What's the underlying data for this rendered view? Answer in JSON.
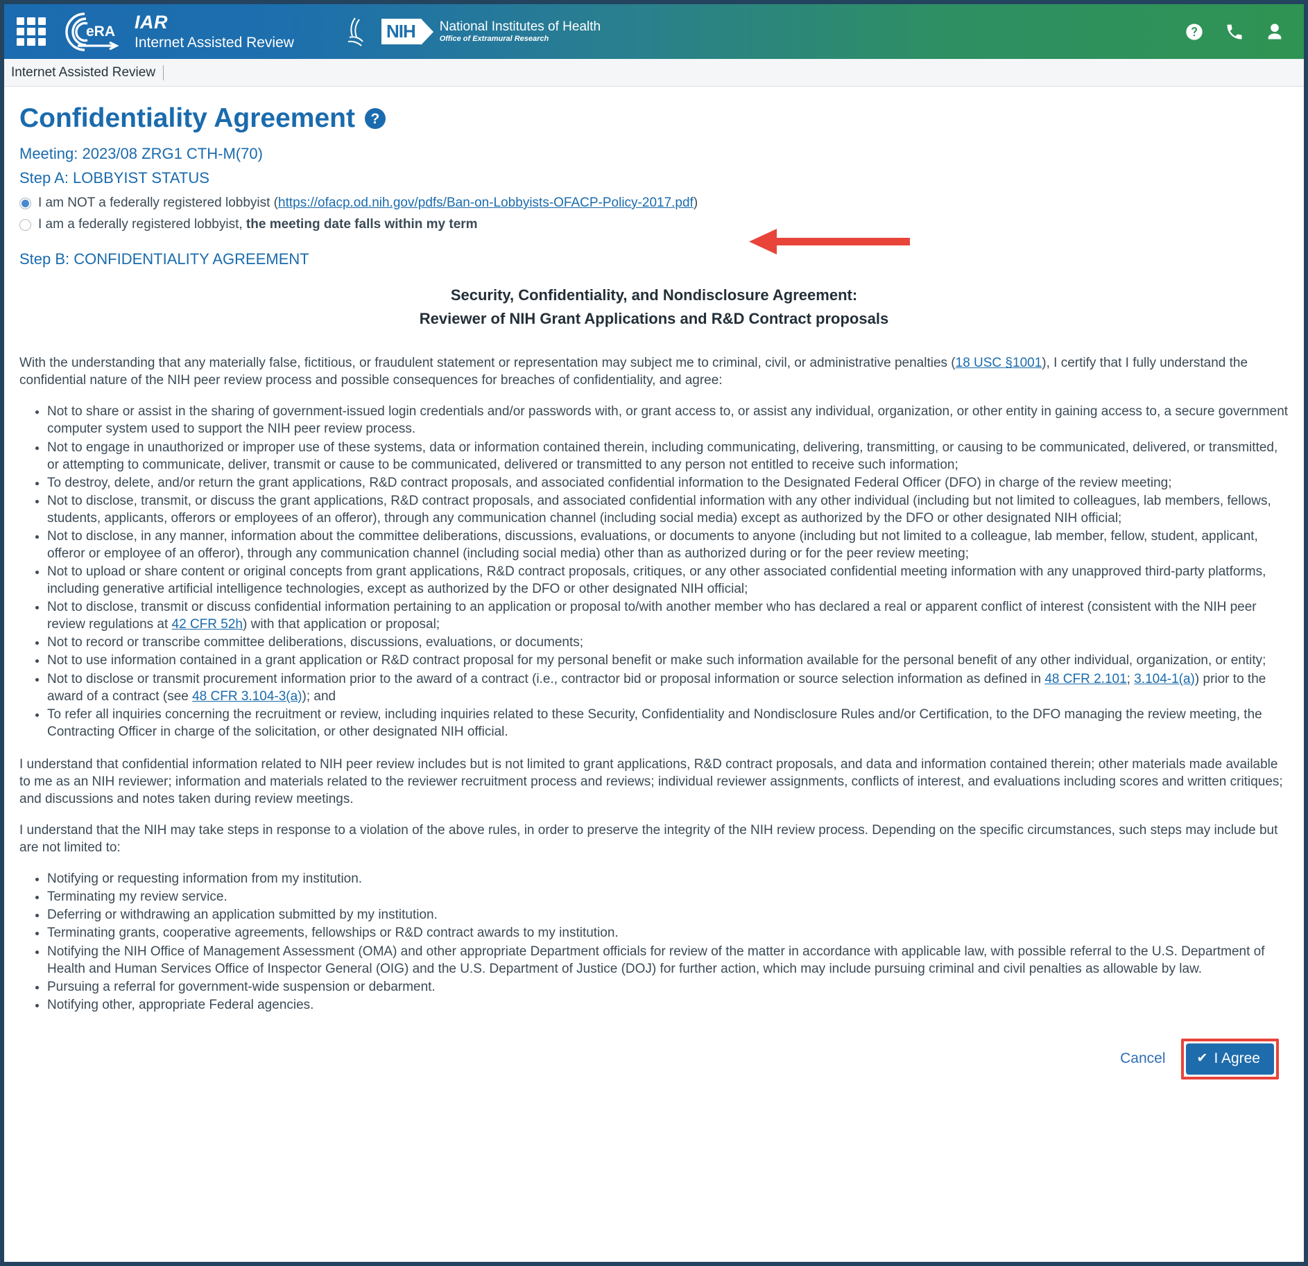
{
  "header": {
    "app_abbr": "IAR",
    "app_name": "Internet Assisted Review",
    "nih_badge": "NIH",
    "nih_line1": "National Institutes of Health",
    "nih_line2": "Office of Extramural Research",
    "icons": [
      "waffle-menu-icon",
      "era-logo-icon",
      "hhs-logo-icon",
      "help-icon",
      "phone-icon",
      "user-icon"
    ],
    "gradient_start": "#1b6bb0",
    "gradient_end": "#2f9353"
  },
  "breadcrumb": {
    "items": [
      "Internet Assisted Review"
    ]
  },
  "page": {
    "title": "Confidentiality Agreement",
    "help_glyph": "?",
    "meeting": "Meeting: 2023/08 ZRG1 CTH-M(70)",
    "step_a_heading": "Step A: LOBBYIST STATUS",
    "step_b_heading": "Step B: CONFIDENTIALITY AGREEMENT",
    "accent_color": "#1a6bad"
  },
  "lobbyist": {
    "option1": {
      "selected": true,
      "text_before": "I am NOT a federally registered lobbyist (",
      "link": "https://ofacp.od.nih.gov/pdfs/Ban-on-Lobbyists-OFACP-Policy-2017.pdf",
      "text_after": ")"
    },
    "option2": {
      "selected": false,
      "text_plain": "I am a federally registered lobbyist, ",
      "text_bold": "the meeting date falls within my term"
    }
  },
  "agreement": {
    "title_line1": "Security, Confidentiality, and Nondisclosure Agreement:",
    "title_line2": "Reviewer of NIH Grant Applications and R&D Contract proposals",
    "intro_part1": "With the understanding that any materially false, fictitious, or fraudulent statement or representation may subject me to criminal, civil, or administrative penalties (",
    "intro_link": "18 USC §1001",
    "intro_part2": "), I certify that I fully understand the confidential nature of the NIH peer review process and possible consequences for breaches of confidentiality, and agree:",
    "rules": [
      "Not to share or assist in the sharing of government-issued login credentials and/or passwords with, or grant access to, or assist any individual, organization, or other entity in gaining access to, a secure government computer system used to support the NIH peer review process.",
      "Not to engage in unauthorized or improper use of these systems, data or information contained therein, including communicating, delivering, transmitting, or causing to be communicated, delivered, or transmitted, or attempting to communicate, deliver, transmit or cause to be communicated, delivered or transmitted to any person not entitled to receive such information;",
      "To destroy, delete, and/or return the grant applications, R&D contract proposals, and associated confidential information to the Designated Federal Officer (DFO) in charge of the review meeting;",
      "Not to disclose, transmit, or discuss the grant applications, R&D contract proposals, and associated confidential information with any other individual (including but not limited to colleagues, lab members, fellows, students, applicants, offerors or employees of an offeror), through any communication channel (including social media) except as authorized by the DFO or other designated NIH official;",
      "Not to disclose, in any manner, information about the committee deliberations, discussions, evaluations, or documents to anyone (including but not limited to a colleague, lab member, fellow, student, applicant, offeror or employee of an offeror), through any communication channel (including social media) other than as authorized during or for the peer review meeting;",
      "Not to upload or share content or original concepts from grant applications, R&D contract proposals, critiques, or any other associated confidential meeting information with any unapproved third-party platforms, including generative artificial intelligence technologies, except as authorized by the DFO or other designated NIH official;",
      "Not to record or transcribe committee deliberations, discussions, evaluations, or documents;",
      "Not to use information contained in a grant application or R&D contract proposal for my personal benefit or make such information available for the personal benefit of any other individual, organization, or entity;",
      "To refer all inquiries concerning the recruitment or review, including inquiries related to these Security, Confidentiality and Nondisclosure Rules and/or Certification, to the DFO managing the review meeting, the Contracting Officer in charge of the solicitation, or other designated NIH official."
    ],
    "rule_coi_part1": "Not to disclose, transmit or discuss confidential information pertaining to an application or proposal to/with another member who has declared a real or apparent conflict of interest (consistent with the NIH peer review regulations at ",
    "rule_coi_link": "42 CFR 52h",
    "rule_coi_part2": ") with that application or proposal;",
    "rule_proc_part1": "Not to disclose or transmit procurement information prior to the award of a contract (i.e., contractor bid or proposal information or source selection information as defined in ",
    "rule_proc_link1": "48 CFR 2.101",
    "rule_proc_sep": "; ",
    "rule_proc_link2": "3.104-1(a)",
    "rule_proc_part2": ") prior to the award of a contract (see ",
    "rule_proc_link3": "48 CFR 3.104-3(a)",
    "rule_proc_part3": "); and",
    "para_confidential": "I understand that confidential information related to NIH peer review includes but is not limited to grant applications, R&D contract proposals, and data and information contained therein; other materials made available to me as an NIH reviewer; information and materials related to the reviewer recruitment process and reviews; individual reviewer assignments, conflicts of interest, and evaluations including scores and written critiques; and discussions and notes taken during review meetings.",
    "para_steps": "I understand that the NIH may take steps in response to a violation of the above rules, in order to preserve the integrity of the NIH review process. Depending on the specific circumstances, such steps may include but are not limited to:",
    "steps": [
      "Notifying or requesting information from my institution.",
      "Terminating my review service.",
      "Deferring or withdrawing an application submitted by my institution.",
      "Terminating grants, cooperative agreements, fellowships or R&D contract awards to my institution.",
      "Notifying the NIH Office of Management Assessment (OMA) and other appropriate Department officials for review of the matter in accordance with applicable law, with possible referral to the U.S. Department of Health and Human Services Office of Inspector General (OIG) and the U.S. Department of Justice (DOJ) for further action, which may include pursuing criminal and civil penalties as allowable by law.",
      "Pursuing a referral for government-wide suspension or debarment.",
      "Notifying other, appropriate Federal agencies."
    ]
  },
  "actions": {
    "cancel_label": "Cancel",
    "agree_label": "I Agree",
    "agree_check_glyph": "✔",
    "agree_button_color": "#1f6cad",
    "highlight_color": "#e8443a"
  },
  "annotation": {
    "arrow_color": "#e8443a",
    "arrow_direction": "left",
    "points_at": "lobbyist-option-1"
  }
}
